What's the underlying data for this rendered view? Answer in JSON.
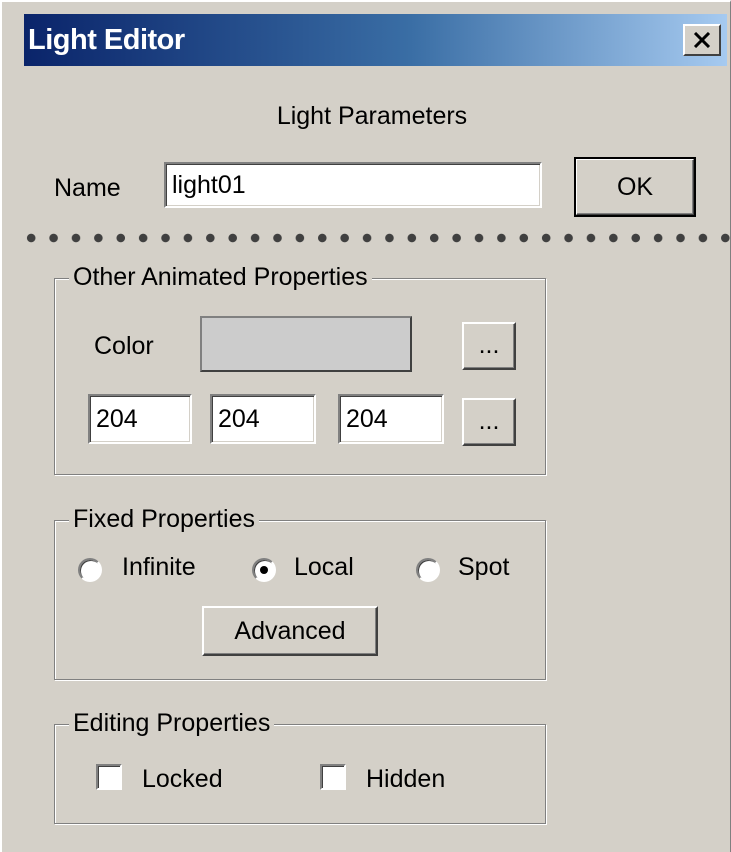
{
  "window": {
    "title": "Light Editor",
    "close_icon": "close-icon"
  },
  "header": {
    "heading": "Light Parameters"
  },
  "name_row": {
    "label": "Name",
    "value": "light01",
    "ok_label": "OK"
  },
  "animated": {
    "legend": "Other Animated Properties",
    "color_label": "Color",
    "color_swatch": "#cccccc",
    "browse_label": "...",
    "rgb": [
      "204",
      "204",
      "204"
    ],
    "rgb_browse_label": "..."
  },
  "fixed": {
    "legend": "Fixed Properties",
    "options": [
      "Infinite",
      "Local",
      "Spot"
    ],
    "selected": "Local",
    "advanced_label": "Advanced"
  },
  "editing": {
    "legend": "Editing Properties",
    "locked_label": "Locked",
    "hidden_label": "Hidden",
    "locked": false,
    "hidden": false
  }
}
